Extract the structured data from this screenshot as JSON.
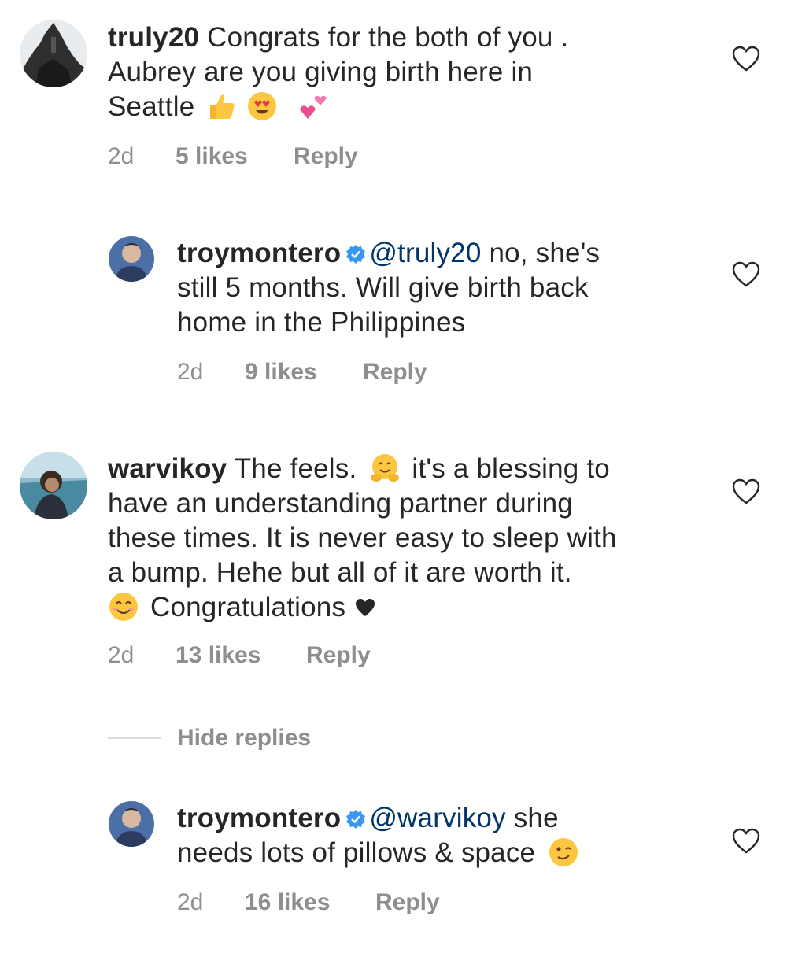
{
  "comments": [
    {
      "username": "truly20",
      "text_line1": "Congrats for the both of you .",
      "text_line2": "Aubrey are you giving birth here in",
      "text_line3": "Seattle",
      "time": "2d",
      "likes": "5 likes",
      "reply_label": "Reply",
      "emojis": [
        "thumbs-up-icon",
        "heart-eyes-icon",
        "two-hearts-icon"
      ]
    },
    {
      "username": "troymontero",
      "mention": "@truly20",
      "text_line1_rest": " no, she's",
      "text_line2": "still 5 months. Will give birth back",
      "text_line3": "home in the Philippines",
      "time": "2d",
      "likes": "9 likes",
      "reply_label": "Reply"
    },
    {
      "username": "warvikoy",
      "text_line1_a": "The feels.",
      "text_line1_b": "it's a blessing to",
      "text_line2": "have an understanding partner during",
      "text_line3": "these times. It is never easy to sleep with",
      "text_line4": "a bump. Hehe but all of it are worth it.",
      "text_line5": "Congratulations",
      "time": "2d",
      "likes": "13 likes",
      "reply_label": "Reply"
    },
    {
      "username": "troymontero",
      "mention": "@warvikoy",
      "text_line1_rest": " she",
      "text_line2": "needs lots of pillows & space",
      "time": "2d",
      "likes": "16 likes",
      "reply_label": "Reply"
    }
  ],
  "hide_replies_label": "Hide replies",
  "colors": {
    "text": "#262626",
    "meta": "#8e8e8e",
    "mention": "#003569",
    "verified": "#3897f0"
  }
}
